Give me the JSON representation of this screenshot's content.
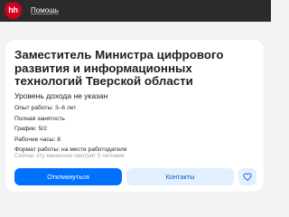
{
  "header": {
    "logo_text": "hh",
    "help_link": "Помощь",
    "logo_color": "#d6001c",
    "bar_color": "#2b2b2b"
  },
  "vacancy": {
    "title": "Заместитель Министра цифрового развития и информационных технологий Тверской области",
    "salary": "Уровень дохода не указан",
    "details": [
      "Опыт работы: 3–6 лет",
      "Полная занятость",
      "График: 5/2",
      "Рабочие часы: 8",
      "Формат работы: на месте работодателя"
    ],
    "viewers": "Сейчас эту вакансию смотрят 5 человек"
  },
  "actions": {
    "apply_label": "Откликнуться",
    "contacts_label": "Контакты",
    "favorite_icon": "heart-icon",
    "primary_color": "#0070ff",
    "secondary_color": "#e1efff"
  }
}
